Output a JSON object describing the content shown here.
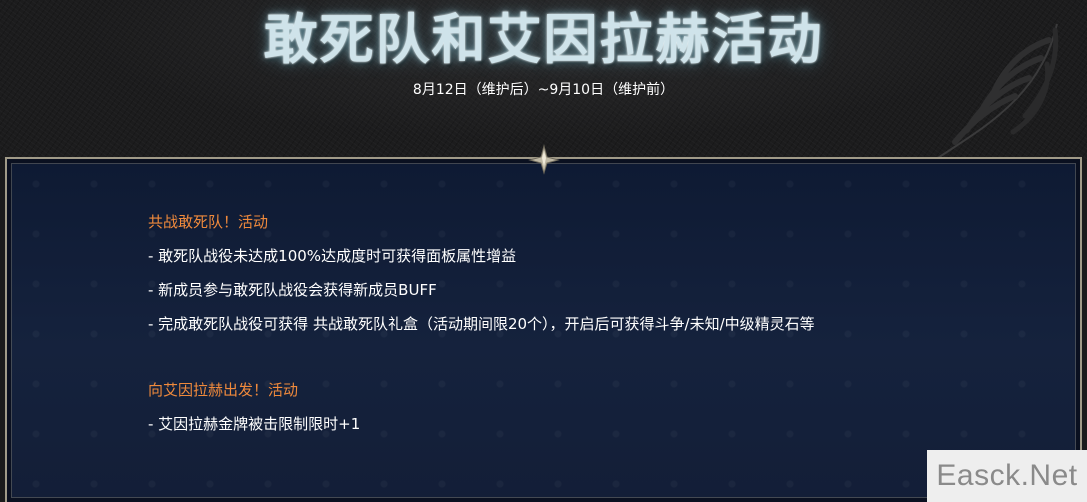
{
  "header": {
    "title": "敢死队和艾因拉赫活动",
    "subtitle": "8月12日（维护后）~9月10日（维护前）"
  },
  "sections": [
    {
      "heading": "共战敢死队！活动",
      "items": [
        "- 敢死队战役未达成100%达成度时可获得面板属性增益",
        "- 新成员参与敢死队战役会获得新成员BUFF",
        "- 完成敢死队战役可获得 共战敢死队礼盒（活动期间限20个），开启后可获得斗争/未知/中级精灵石等"
      ]
    },
    {
      "heading": "向艾因拉赫出发！活动",
      "items": [
        "- 艾因拉赫金牌被击限制限时+1"
      ]
    }
  ],
  "watermark": "Easck.Net",
  "colors": {
    "heading": "#f08a3c",
    "body_text": "#ffffff",
    "panel_bg": "#15223d",
    "panel_border": "#a09a88",
    "title_glow": "#cfe3ea"
  },
  "icons": [
    "feather-decoration-icon",
    "diamond-ornament-icon"
  ]
}
